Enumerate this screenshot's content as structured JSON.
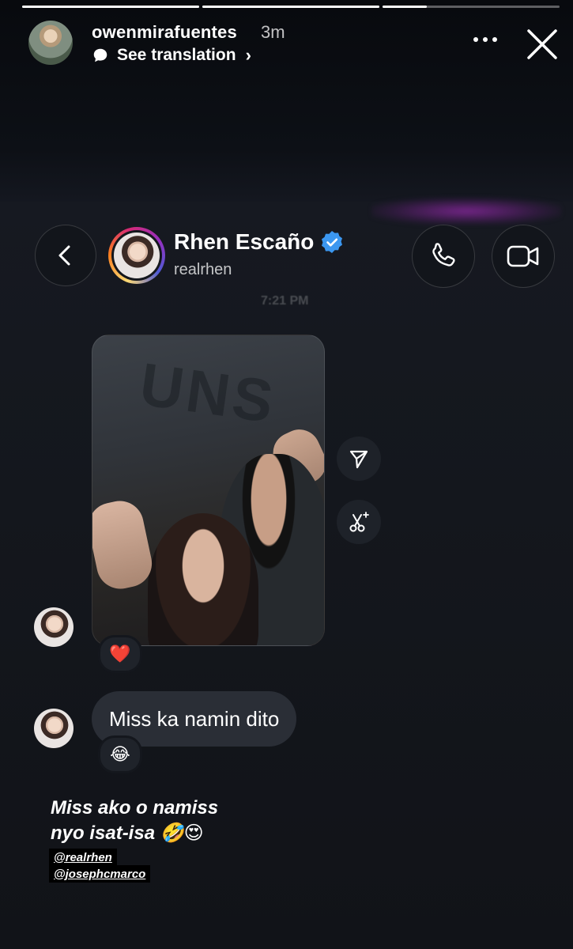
{
  "story": {
    "progress": [
      1,
      1,
      0.25
    ],
    "username": "owenmirafuentes",
    "time": "3m",
    "see_translation": "See translation",
    "icons": {
      "more": "more-icon",
      "close": "close-icon",
      "translate": "speech-bubble-icon"
    }
  },
  "chat": {
    "contact_name": "Rhen Escaño",
    "contact_handle": "realrhen",
    "timestamp": "7:21 PM",
    "icons": {
      "back": "chevron-left-icon",
      "call": "phone-icon",
      "video": "video-camera-icon",
      "verified": "verified-badge-icon"
    },
    "photo_sign": "UNS",
    "photo_reaction": "❤️",
    "message": "Miss ka namin dito",
    "message_reaction": "😂"
  },
  "caption": {
    "line1": "Miss ako o namiss",
    "line2": "nyo isat-isa 🤣😍",
    "tags": [
      "@realrhen",
      "@josephcmarco"
    ]
  }
}
